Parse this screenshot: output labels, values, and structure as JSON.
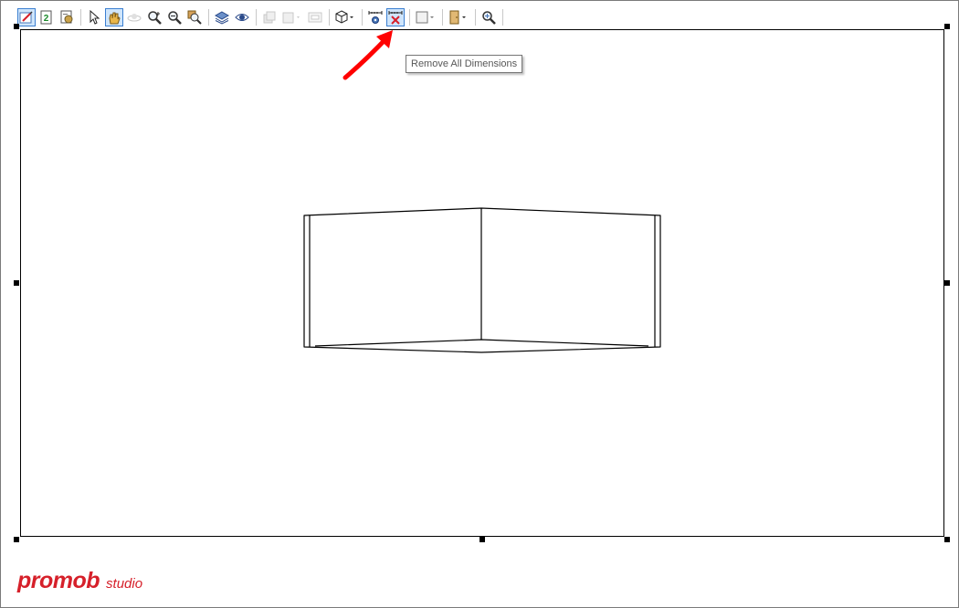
{
  "toolbar": {
    "buttons": [
      {
        "icon": "edit-render-icon",
        "active": true
      },
      {
        "icon": "refresh-icon",
        "active": false
      },
      {
        "icon": "print-settings-icon",
        "active": false
      },
      {
        "icon": "select-cursor-icon",
        "active": false
      },
      {
        "icon": "pan-hand-icon",
        "active": true
      },
      {
        "icon": "orbit-icon",
        "active": false,
        "disabled": true
      },
      {
        "icon": "zoom-in-icon",
        "active": false
      },
      {
        "icon": "zoom-out-icon",
        "active": false
      },
      {
        "icon": "zoom-window-icon",
        "active": false
      },
      {
        "icon": "layers-icon",
        "active": false
      },
      {
        "icon": "visibility-eye-icon",
        "active": false
      },
      {
        "icon": "render-style-icon",
        "active": false,
        "disabled": true
      },
      {
        "icon": "view-style-icon",
        "active": false,
        "disabled": true
      },
      {
        "icon": "frame-icon",
        "active": false,
        "disabled": true
      },
      {
        "icon": "cube-view-icon",
        "active": false
      },
      {
        "icon": "auto-dimensions-icon",
        "active": false
      },
      {
        "icon": "remove-all-dimensions-icon",
        "active": true
      },
      {
        "icon": "color-fill-icon",
        "active": false
      },
      {
        "icon": "door-panel-icon",
        "active": false
      },
      {
        "icon": "zoom-extents-icon",
        "active": false
      }
    ]
  },
  "tooltip": {
    "text": "Remove All Dimensions"
  },
  "branding": {
    "brand": "promob",
    "suffix": "studio",
    "color": "#d6202a"
  },
  "colors": {
    "accent": "#3b7fd1",
    "annotation_arrow": "#ff0000"
  }
}
